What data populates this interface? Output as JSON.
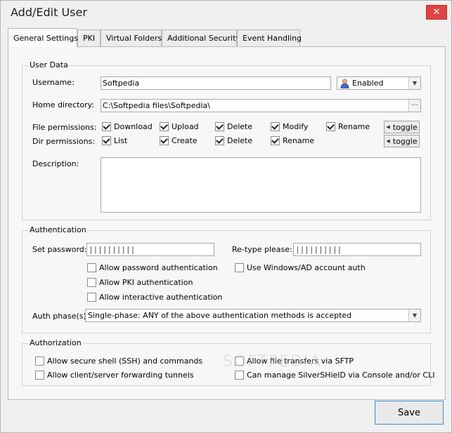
{
  "window": {
    "title": "Add/Edit User",
    "close": "✕"
  },
  "tabs": [
    {
      "label": "General Settings",
      "active": true
    },
    {
      "label": "PKI"
    },
    {
      "label": "Virtual Folders"
    },
    {
      "label": "Additional Security"
    },
    {
      "label": "Event Handling"
    }
  ],
  "user_data": {
    "group_label": "User Data",
    "username_label": "Username:",
    "username_value": "Softpedia",
    "status_value": "Enabled",
    "home_label": "Home directory:",
    "home_value": "C:\\Softpedia files\\Softpedia\\",
    "browse": "···",
    "file_perm_label": "File permissions:",
    "file_perms": [
      {
        "label": "Download",
        "checked": true
      },
      {
        "label": "Upload",
        "checked": true
      },
      {
        "label": "Delete",
        "checked": true
      },
      {
        "label": "Modify",
        "checked": true
      },
      {
        "label": "Rename",
        "checked": true
      }
    ],
    "dir_perm_label": "Dir permissions:",
    "dir_perms": [
      {
        "label": "List",
        "checked": true
      },
      {
        "label": "Create",
        "checked": true
      },
      {
        "label": "Delete",
        "checked": true
      },
      {
        "label": "Rename",
        "checked": true
      }
    ],
    "toggle_label": "toggle",
    "description_label": "Description:"
  },
  "authentication": {
    "group_label": "Authentication",
    "set_password_label": "Set password:",
    "set_password_value": "||||||||||",
    "retype_label": "Re-type please:",
    "retype_value": "||||||||||",
    "options": [
      {
        "label": "Allow password authentication",
        "checked": false
      },
      {
        "label": "Allow PKI authentication",
        "checked": false
      },
      {
        "label": "Allow interactive authentication",
        "checked": false
      },
      {
        "label": "Use Windows/AD account auth",
        "checked": false
      }
    ],
    "phase_label": "Auth phase(s):",
    "phase_value": "Single-phase: ANY of the above authentication methods is accepted"
  },
  "authorization": {
    "group_label": "Authorization",
    "options": [
      {
        "label": "Allow secure shell (SSH) and commands",
        "checked": false
      },
      {
        "label": "Allow client/server forwarding tunnels",
        "checked": false
      },
      {
        "label": "Allow file transfers via SFTP",
        "checked": false
      },
      {
        "label": "Can manage SilverSHielD via Console and/or CLI",
        "checked": false
      }
    ]
  },
  "footer": {
    "save_label": "Save"
  },
  "watermark": "SOFTPEDIA"
}
